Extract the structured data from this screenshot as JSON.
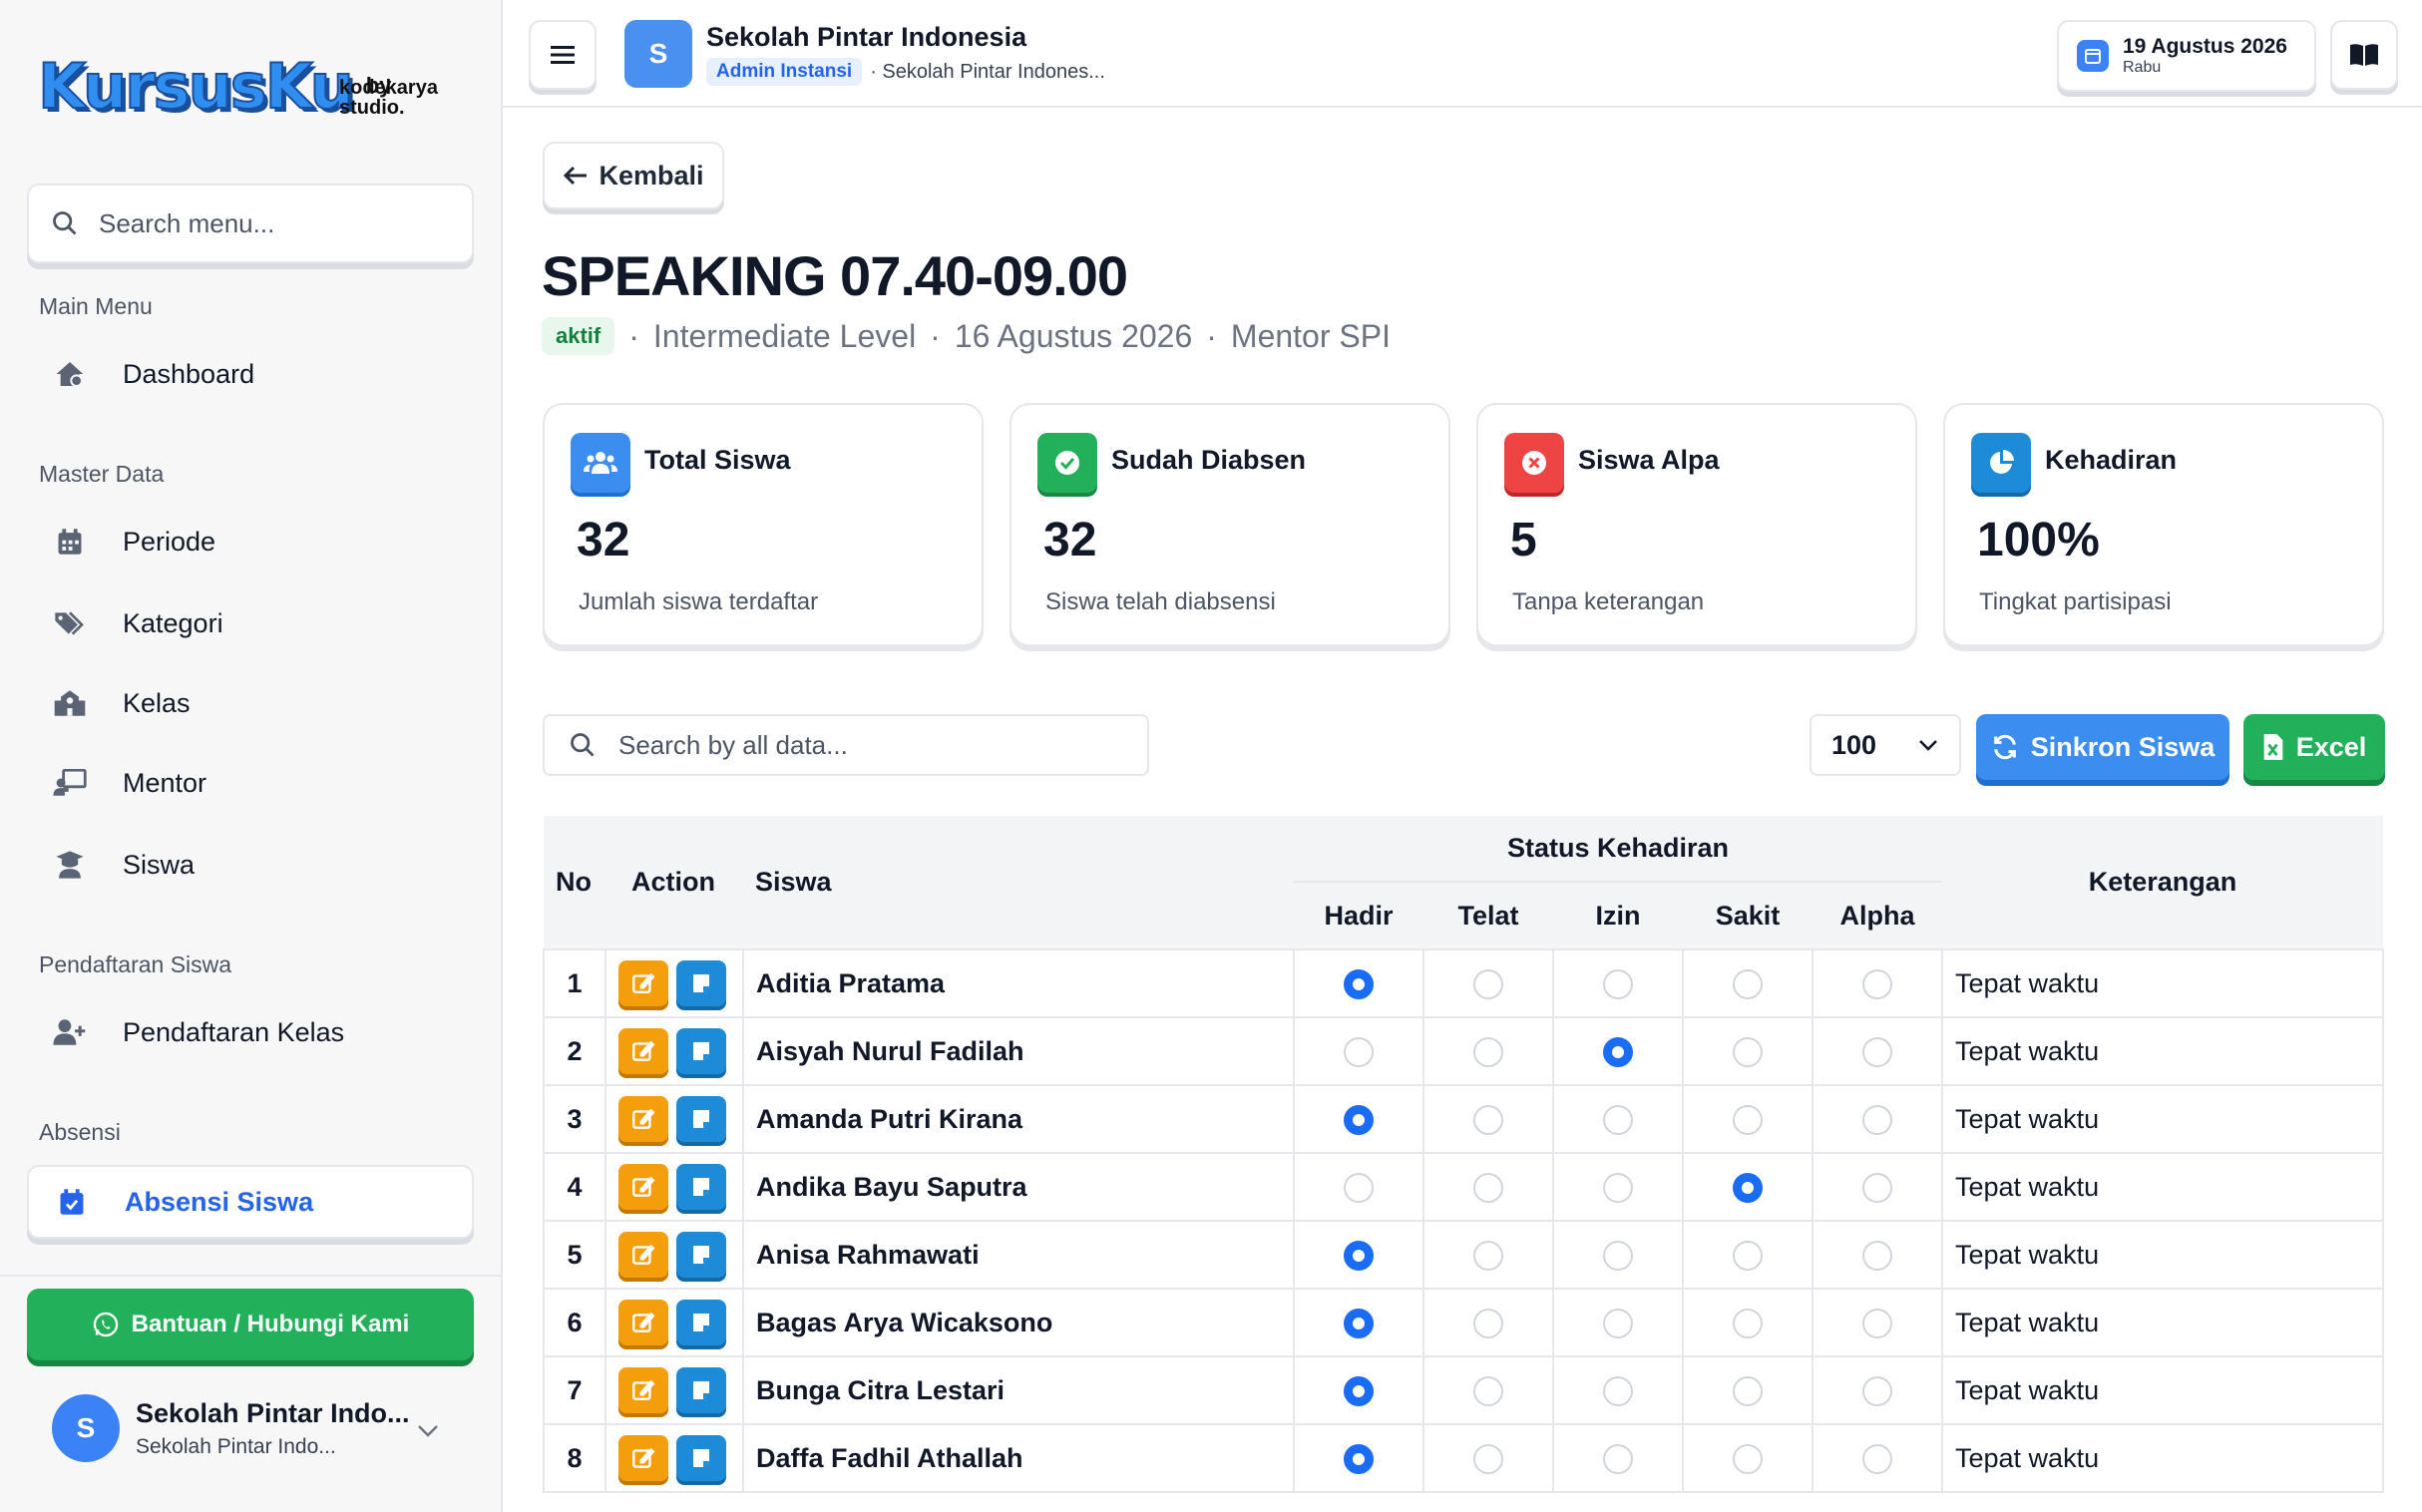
{
  "brand": {
    "logo": "KursusKu",
    "by": "by",
    "studio": "kodekarya studio."
  },
  "sidebar": {
    "search_placeholder": "Search menu...",
    "sections": {
      "main": "Main Menu",
      "master": "Master Data",
      "pendaftaran": "Pendaftaran Siswa",
      "absensi": "Absensi"
    },
    "items": {
      "dashboard": "Dashboard",
      "periode": "Periode",
      "kategori": "Kategori",
      "kelas": "Kelas",
      "mentor": "Mentor",
      "siswa": "Siswa",
      "pendaftaran_kelas": "Pendaftaran Kelas",
      "absensi_siswa": "Absensi Siswa"
    },
    "help_button": "Bantuan / Hubungi Kami",
    "user": {
      "initial": "S",
      "name": "Sekolah Pintar Indo...",
      "sub": "Sekolah Pintar Indo..."
    }
  },
  "topbar": {
    "school_initial": "S",
    "school_name": "Sekolah Pintar Indonesia",
    "role": "Admin Instansi",
    "school_sub": "· Sekolah Pintar Indones...",
    "date": "19 Agustus 2026",
    "day": "Rabu"
  },
  "page": {
    "back_label": "Kembali",
    "title": "SPEAKING 07.40-09.00",
    "status": "aktif",
    "level": "Intermediate Level",
    "date": "16 Agustus 2026",
    "mentor": "Mentor SPI",
    "sep": "·"
  },
  "stats": [
    {
      "title": "Total Siswa",
      "value": "32",
      "sub": "Jumlah siswa terdaftar",
      "color": "#3b8ef0",
      "icon": "users-icon"
    },
    {
      "title": "Sudah Diabsen",
      "value": "32",
      "sub": "Siswa telah diabsensi",
      "color": "#22b05b",
      "icon": "check-circle-icon"
    },
    {
      "title": "Siswa Alpa",
      "value": "5",
      "sub": "Tanpa keterangan",
      "color": "#ef4444",
      "icon": "x-circle-icon"
    },
    {
      "title": "Kehadiran",
      "value": "100%",
      "sub": "Tingkat partisipasi",
      "color": "#1d8bd8",
      "icon": "pie-chart-icon"
    }
  ],
  "toolbar": {
    "search_placeholder": "Search by all data...",
    "per_page": "100",
    "sync_label": "Sinkron Siswa",
    "excel_label": "Excel"
  },
  "table": {
    "headers": {
      "no": "No",
      "action": "Action",
      "siswa": "Siswa",
      "status": "Status Kehadiran",
      "keterangan": "Keterangan"
    },
    "status_cols": [
      "Hadir",
      "Telat",
      "Izin",
      "Sakit",
      "Alpha"
    ],
    "rows": [
      {
        "no": "1",
        "name": "Aditia Pratama",
        "status": 0,
        "ket": "Tepat waktu"
      },
      {
        "no": "2",
        "name": "Aisyah Nurul Fadilah",
        "status": 2,
        "ket": "Tepat waktu"
      },
      {
        "no": "3",
        "name": "Amanda Putri Kirana",
        "status": 0,
        "ket": "Tepat waktu"
      },
      {
        "no": "4",
        "name": "Andika Bayu Saputra",
        "status": 3,
        "ket": "Tepat waktu"
      },
      {
        "no": "5",
        "name": "Anisa Rahmawati",
        "status": 0,
        "ket": "Tepat waktu"
      },
      {
        "no": "6",
        "name": "Bagas Arya Wicaksono",
        "status": 0,
        "ket": "Tepat waktu"
      },
      {
        "no": "7",
        "name": "Bunga Citra Lestari",
        "status": 0,
        "ket": "Tepat waktu"
      },
      {
        "no": "8",
        "name": "Daffa Fadhil Athallah",
        "status": 0,
        "ket": "Tepat waktu"
      }
    ]
  }
}
